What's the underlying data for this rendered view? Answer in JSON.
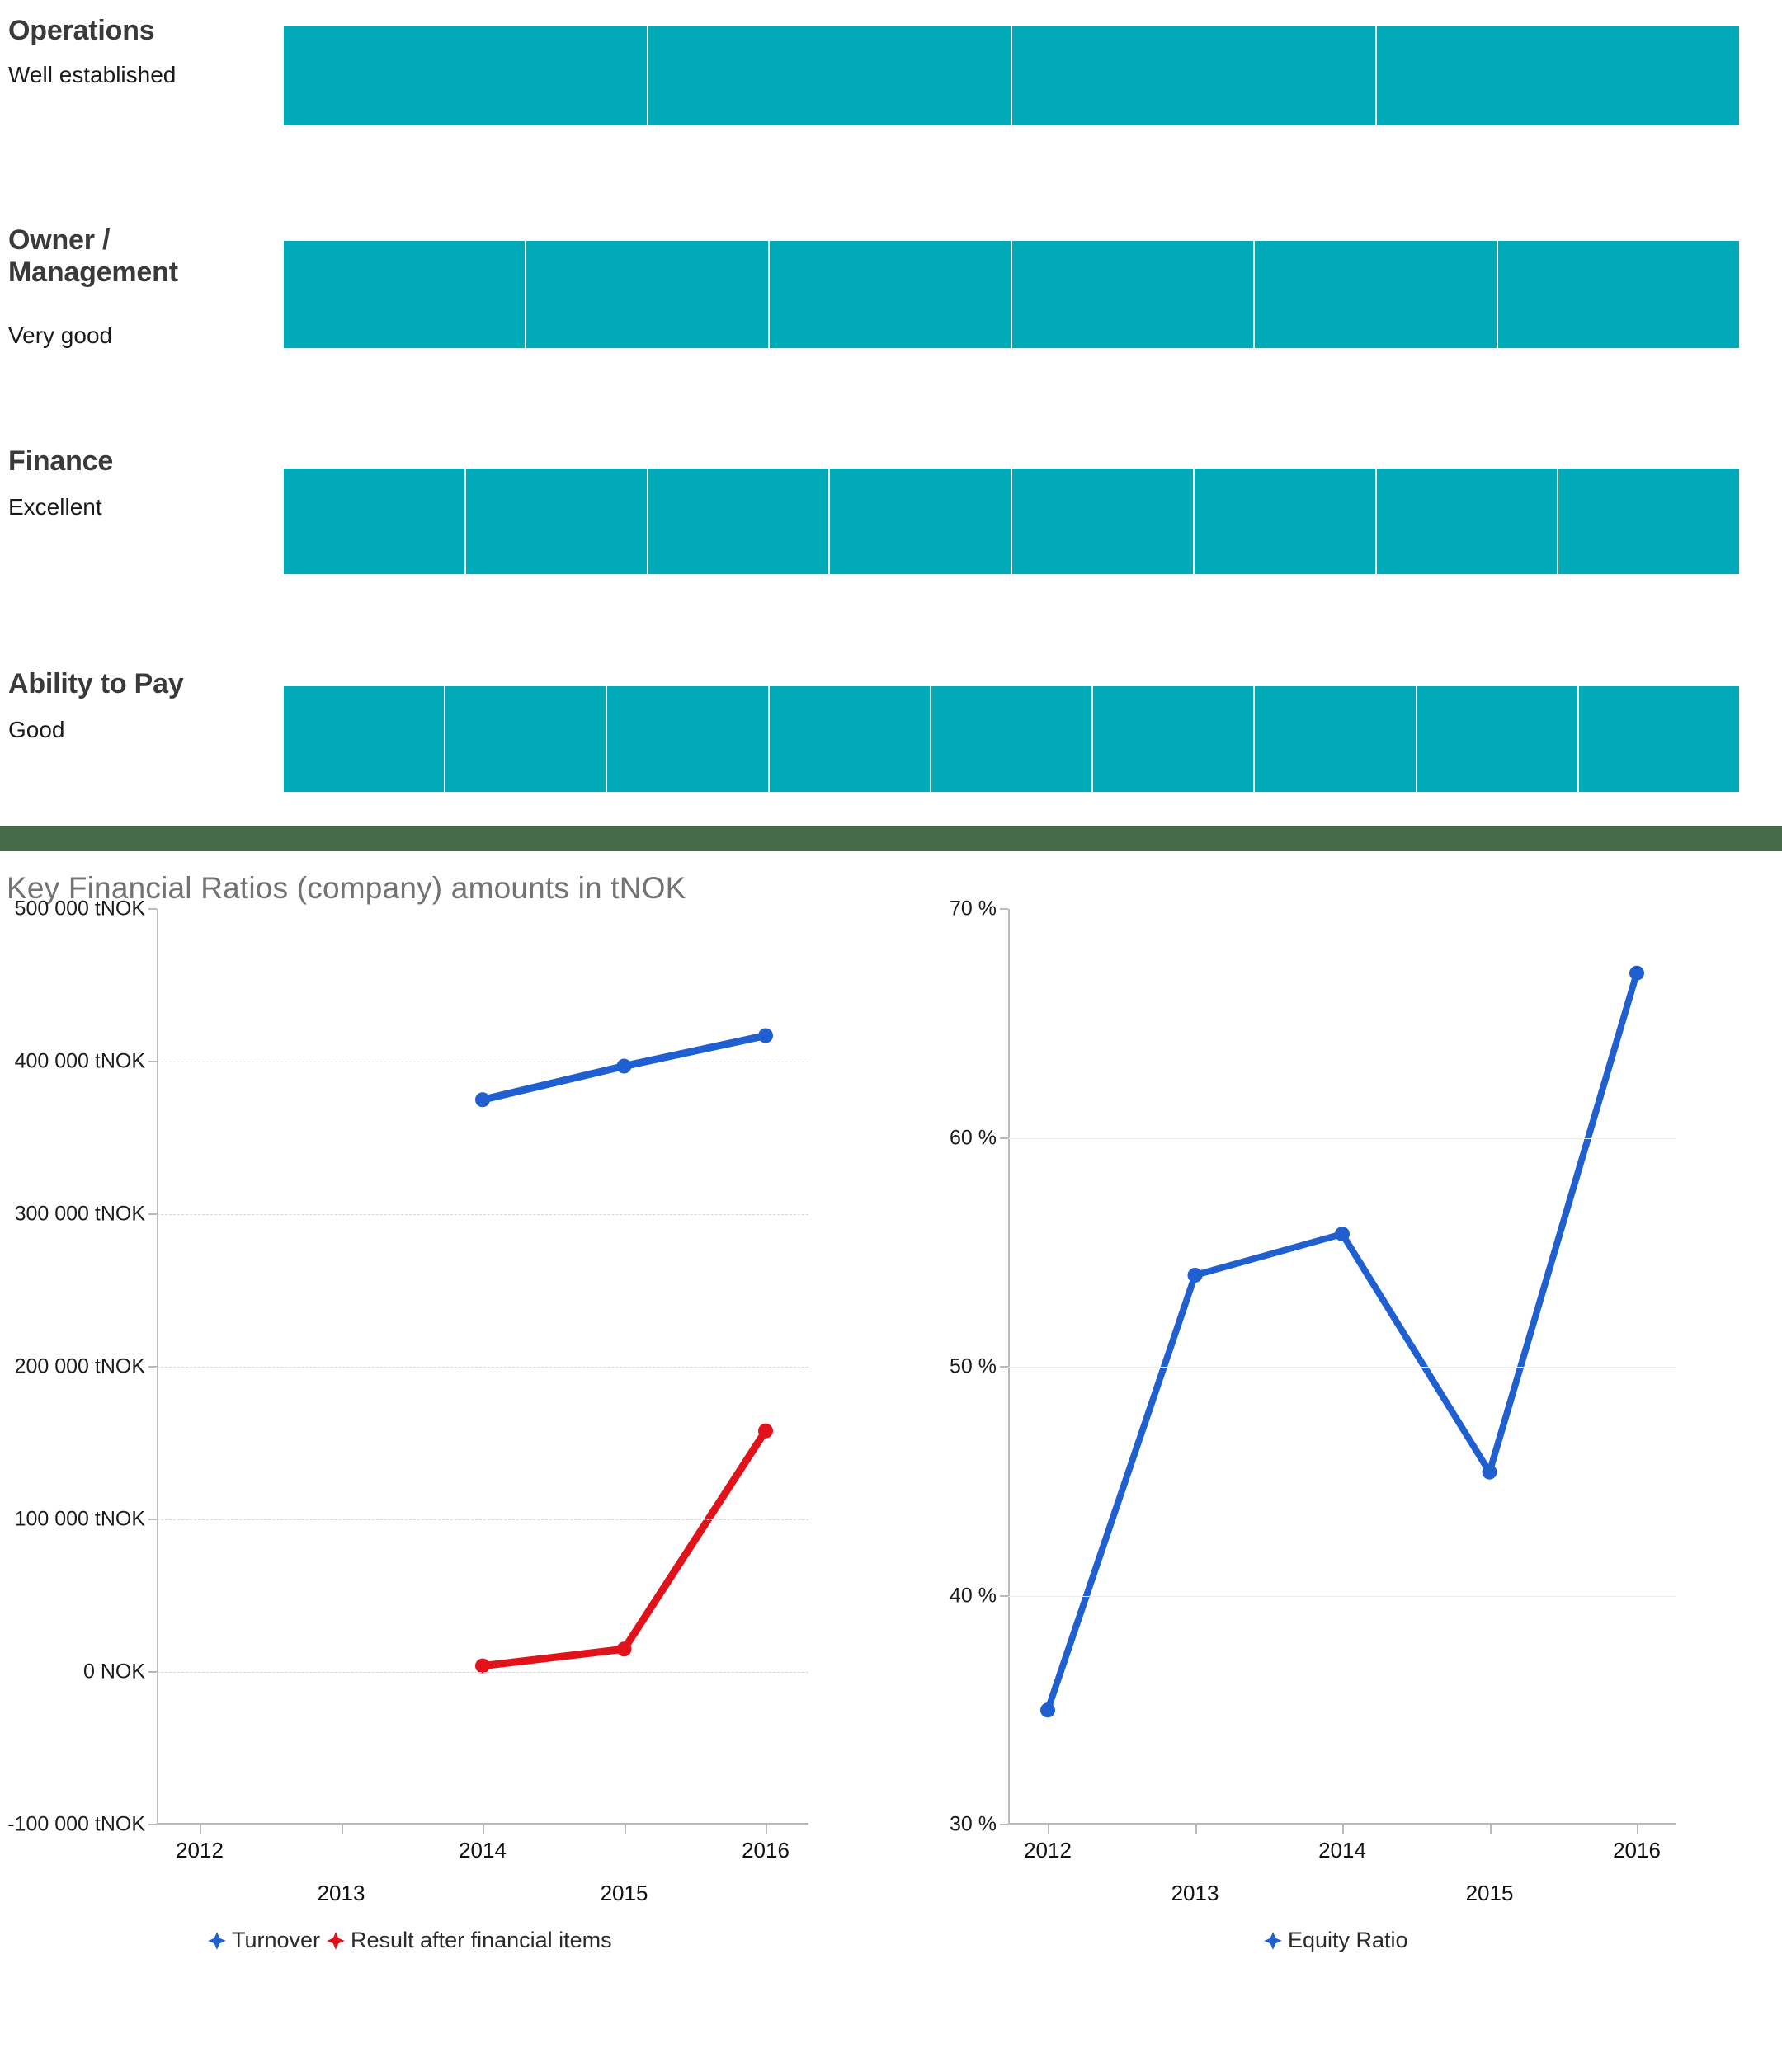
{
  "ratings": {
    "items": [
      {
        "title": "Operations",
        "rating_text": "Well established",
        "segments": 4,
        "bar_width_pct": 100
      },
      {
        "title": "Owner / Management",
        "rating_text": "Very good",
        "segments": 6,
        "bar_width_pct": 100
      },
      {
        "title": "Finance",
        "rating_text": "Excellent",
        "segments": 8,
        "bar_width_pct": 100
      },
      {
        "title": "Ability to Pay",
        "rating_text": "Good",
        "segments": 9,
        "bar_width_pct": 100
      }
    ],
    "bar_color": "#00aab9",
    "divider_color": "#e9fbfd"
  },
  "divider": {
    "color": "#456b48"
  },
  "financial": {
    "heading": "Key Financial Ratios (company) amounts in tNOK"
  },
  "chart_data": [
    {
      "type": "line",
      "id": "key-financial-ratios-amounts",
      "title": "",
      "xlabel": "",
      "ylabel": "",
      "categories": [
        "2012",
        "2013",
        "2014",
        "2015",
        "2016"
      ],
      "x_tick_labels": [
        "2012",
        "2013",
        "2014",
        "2015",
        "2016"
      ],
      "y_tick_labels": [
        "500 000 tNOK",
        "400 000 tNOK",
        "300 000 tNOK",
        "200 000 tNOK",
        "100 000 tNOK",
        "0 NOK",
        "-100 000 tNOK"
      ],
      "y_tick_values": [
        500000,
        400000,
        300000,
        200000,
        100000,
        0,
        -100000
      ],
      "ylim": [
        -100000,
        500000
      ],
      "grid": true,
      "legend_position": "bottom",
      "series": [
        {
          "name": "Turnover",
          "color": "#1f5fd0",
          "x": [
            "2014",
            "2015",
            "2016"
          ],
          "values": [
            375000,
            397000,
            417000
          ]
        },
        {
          "name": "Result after financial items",
          "color": "#e11219",
          "x": [
            "2014",
            "2015",
            "2016"
          ],
          "values": [
            4000,
            15000,
            158000
          ]
        }
      ]
    },
    {
      "type": "line",
      "id": "equity-ratio",
      "title": "",
      "xlabel": "",
      "ylabel": "",
      "categories": [
        "2012",
        "2013",
        "2014",
        "2015",
        "2016"
      ],
      "x_tick_labels": [
        "2012",
        "2013",
        "2014",
        "2015",
        "2016"
      ],
      "y_tick_labels": [
        "70 %",
        "60 %",
        "50 %",
        "40 %",
        "30 %"
      ],
      "y_tick_values": [
        70,
        60,
        50,
        40,
        30
      ],
      "ylim": [
        30,
        70
      ],
      "grid": true,
      "legend_position": "bottom",
      "series": [
        {
          "name": "Equity Ratio",
          "color": "#1f5fd0",
          "x": [
            "2012",
            "2013",
            "2014",
            "2015",
            "2016"
          ],
          "values": [
            35.0,
            54.0,
            55.8,
            45.4,
            67.2
          ]
        }
      ]
    }
  ]
}
